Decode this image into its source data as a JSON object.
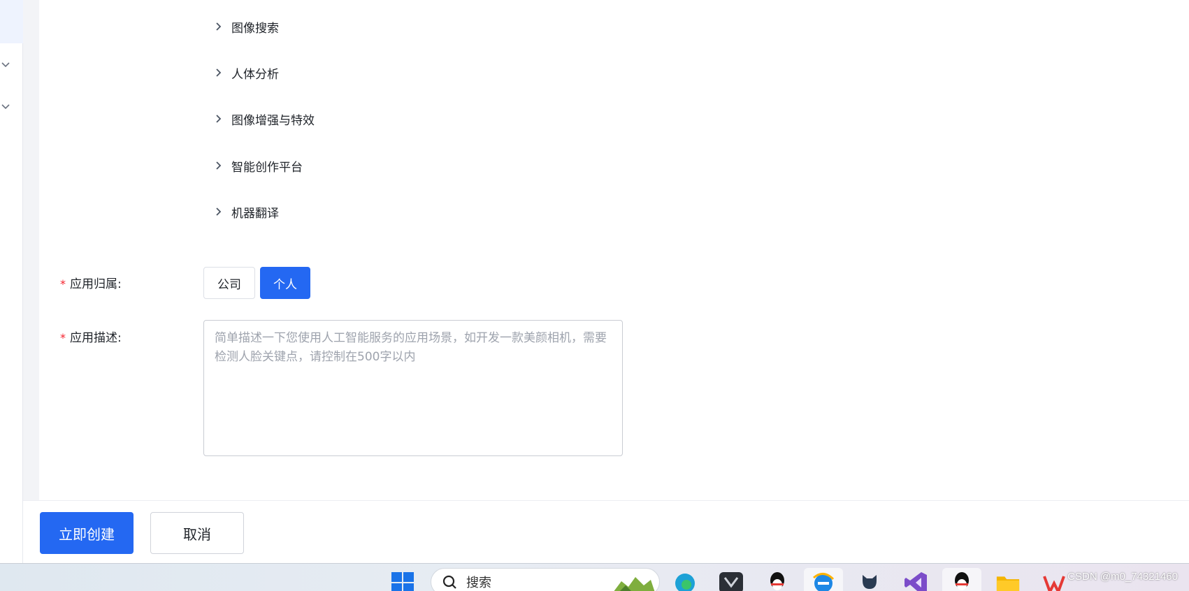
{
  "categories": [
    {
      "label": "图像搜索"
    },
    {
      "label": "人体分析"
    },
    {
      "label": "图像增强与特效"
    },
    {
      "label": "智能创作平台"
    },
    {
      "label": "机器翻译"
    }
  ],
  "form": {
    "ownership": {
      "required_mark": "*",
      "label": "应用归属:",
      "options": [
        "公司",
        "个人"
      ],
      "selected": "个人"
    },
    "description": {
      "required_mark": "*",
      "label": "应用描述:",
      "value": "",
      "placeholder": "简单描述一下您使用人工智能服务的应用场景，如开发一款美颜相机，需要检测人脸关键点，请控制在500字以内"
    }
  },
  "footer": {
    "create_label": "立即创建",
    "cancel_label": "取消"
  },
  "taskbar": {
    "search_label": "搜索",
    "watermark": "CSDN @m0_74321460"
  },
  "colors": {
    "primary": "#2468f2",
    "required": "#f5222d",
    "placeholder": "#9ea3ad"
  }
}
